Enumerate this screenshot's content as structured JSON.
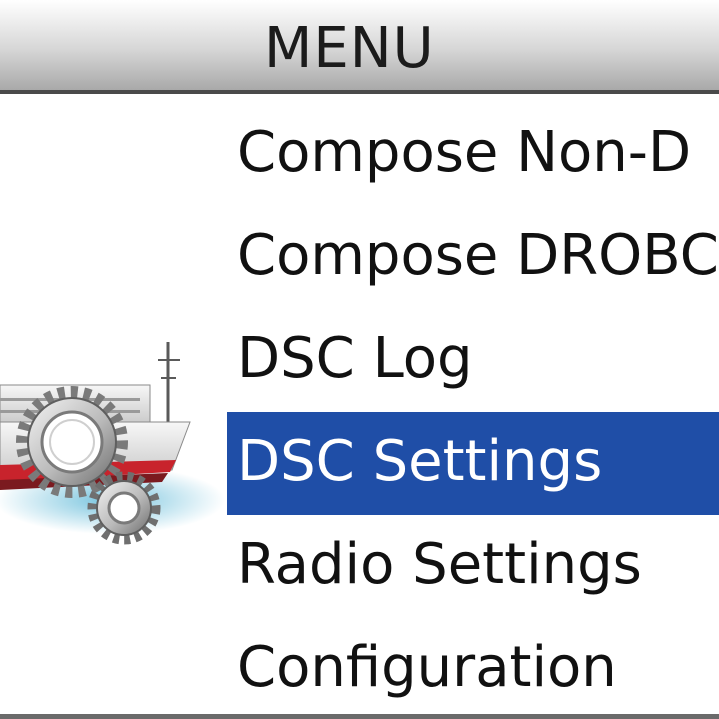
{
  "title": "MENU",
  "menu": {
    "items": [
      {
        "label": "Compose Non-D"
      },
      {
        "label": "Compose DROBC"
      },
      {
        "label": "DSC Log"
      },
      {
        "label": "DSC Settings",
        "selected": true
      },
      {
        "label": "Radio Settings"
      },
      {
        "label": "Configuration"
      }
    ]
  },
  "icons": {
    "illustration": "ship-with-gears-icon"
  },
  "colors": {
    "selection": "#1f4ea7",
    "selected_text": "#ffffff",
    "text": "#111111",
    "title_bar_dark": "#a9a9a9",
    "hull_red": "#c8232c"
  }
}
